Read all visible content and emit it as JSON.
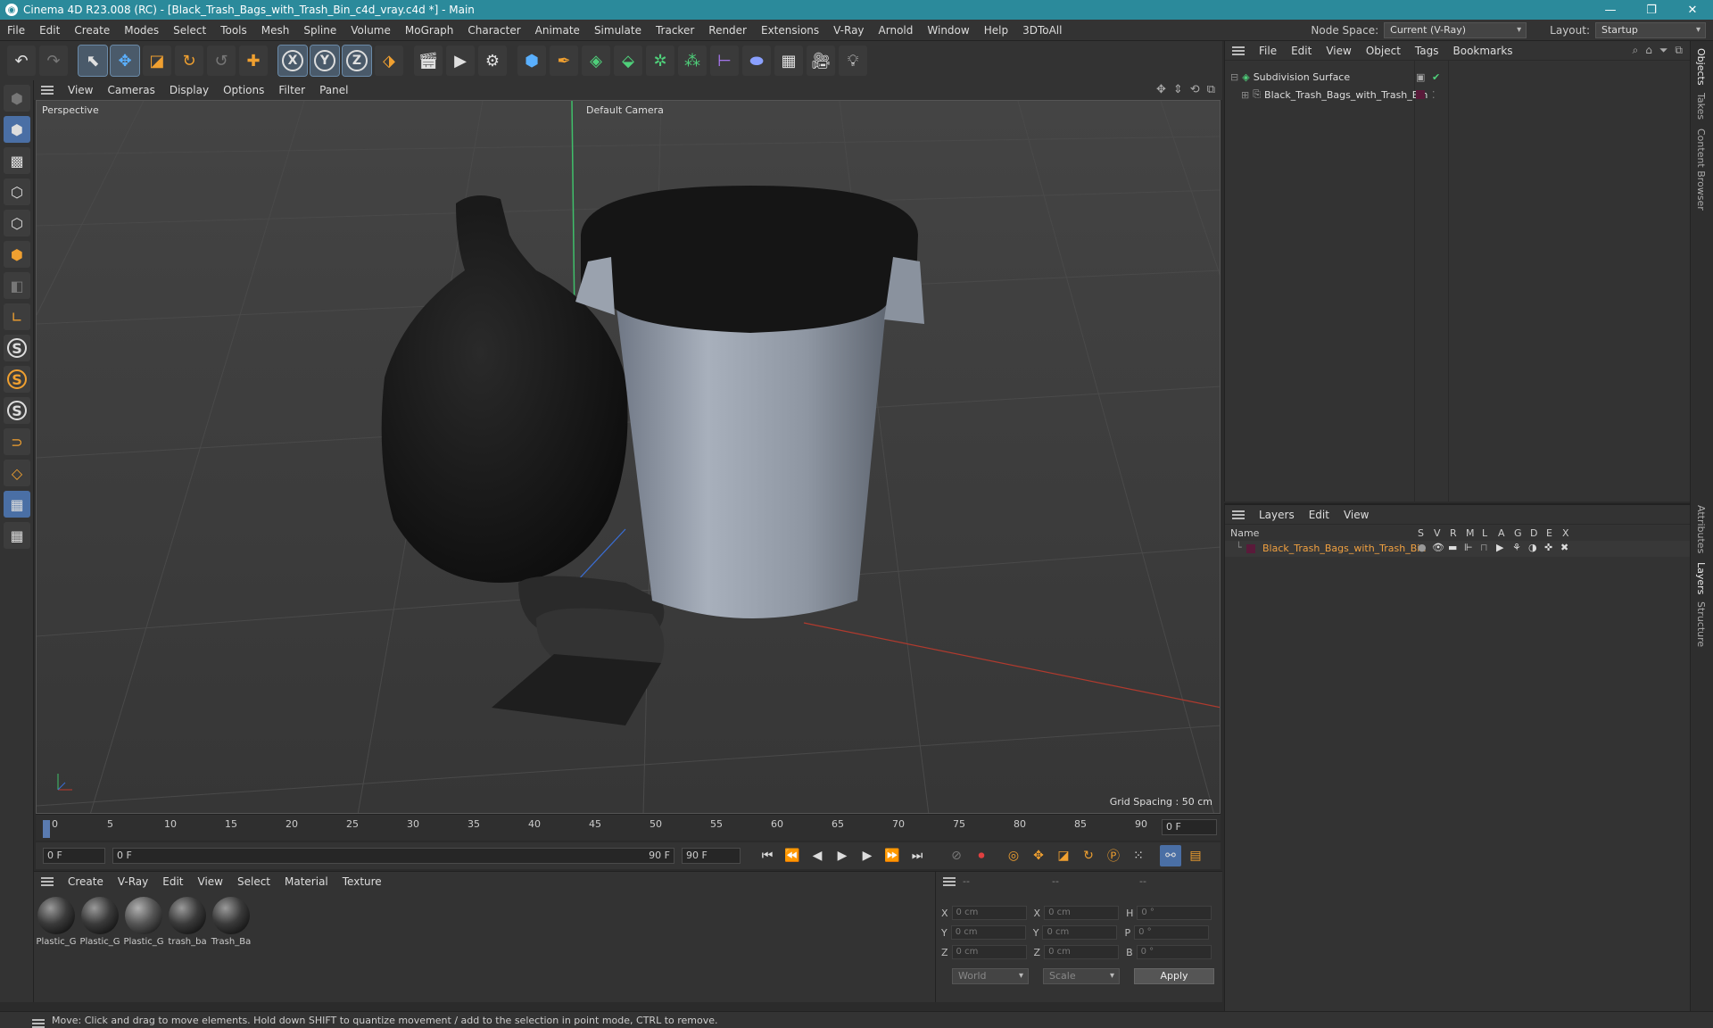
{
  "window": {
    "title": "Cinema 4D R23.008 (RC) - [Black_Trash_Bags_with_Trash_Bin_c4d_vray.c4d *] - Main",
    "controls": [
      "—",
      "❐",
      "✕"
    ]
  },
  "menubar": {
    "items": [
      "File",
      "Edit",
      "Create",
      "Modes",
      "Select",
      "Tools",
      "Mesh",
      "Spline",
      "Volume",
      "MoGraph",
      "Character",
      "Animate",
      "Simulate",
      "Tracker",
      "Render",
      "Extensions",
      "V-Ray",
      "Arnold",
      "Window",
      "Help",
      "3DToAll"
    ],
    "node_space_label": "Node Space:",
    "node_space_value": "Current (V-Ray)",
    "layout_label": "Layout:",
    "layout_value": "Startup"
  },
  "toolbar": {
    "axis_x": "X",
    "axis_y": "Y",
    "axis_z": "Z"
  },
  "viewport": {
    "menu": [
      "View",
      "Cameras",
      "Display",
      "Options",
      "Filter",
      "Panel"
    ],
    "label": "Perspective",
    "camera": "Default Camera",
    "grid_spacing": "Grid Spacing : 50 cm"
  },
  "timeline": {
    "ticks": [
      "0",
      "5",
      "10",
      "15",
      "20",
      "25",
      "30",
      "35",
      "40",
      "45",
      "50",
      "55",
      "60",
      "65",
      "70",
      "75",
      "80",
      "85",
      "90"
    ],
    "current_frame": "0 F",
    "start_field": "0 F",
    "range_start": "0 F",
    "range_end": "90 F",
    "end_field": "90 F"
  },
  "materials": {
    "menu": [
      "Create",
      "V-Ray",
      "Edit",
      "View",
      "Select",
      "Material",
      "Texture"
    ],
    "items": [
      "Plastic_G",
      "Plastic_G",
      "Plastic_G",
      "trash_ba",
      "Trash_Ba"
    ]
  },
  "coords": {
    "headers": [
      "--",
      "--",
      "--"
    ],
    "rows": [
      {
        "a": "X",
        "av": "0 cm",
        "b": "X",
        "bv": "0 cm",
        "c": "H",
        "cv": "0 °"
      },
      {
        "a": "Y",
        "av": "0 cm",
        "b": "Y",
        "bv": "0 cm",
        "c": "P",
        "cv": "0 °"
      },
      {
        "a": "Z",
        "av": "0 cm",
        "b": "Z",
        "bv": "0 cm",
        "c": "B",
        "cv": "0 °"
      }
    ],
    "space": "World",
    "mode": "Scale",
    "apply": "Apply"
  },
  "objects": {
    "menu": [
      "File",
      "Edit",
      "View",
      "Object",
      "Tags",
      "Bookmarks"
    ],
    "items": [
      {
        "name": "Subdivision Surface"
      },
      {
        "name": "Black_Trash_Bags_with_Trash_Bin"
      }
    ]
  },
  "layers": {
    "menu": [
      "Layers",
      "Edit",
      "View"
    ],
    "col_name": "Name",
    "cols": [
      "S",
      "V",
      "R",
      "M",
      "L",
      "A",
      "G",
      "D",
      "E",
      "X"
    ],
    "items": [
      {
        "name": "Black_Trash_Bags_with_Trash_Bin",
        "color": "#5a1a3a"
      }
    ]
  },
  "side_tabs": [
    "Objects",
    "Takes",
    "Content Browser",
    "Attributes",
    "Layers",
    "Structure"
  ],
  "status": "Move: Click and drag to move elements. Hold down SHIFT to quantize movement / add to the selection in point mode, CTRL to remove.",
  "colors": {
    "accent": "#2b8a9b",
    "layer_name": "#f0a040",
    "x_axis": "#c0392b",
    "y_axis": "#2ecc71"
  }
}
